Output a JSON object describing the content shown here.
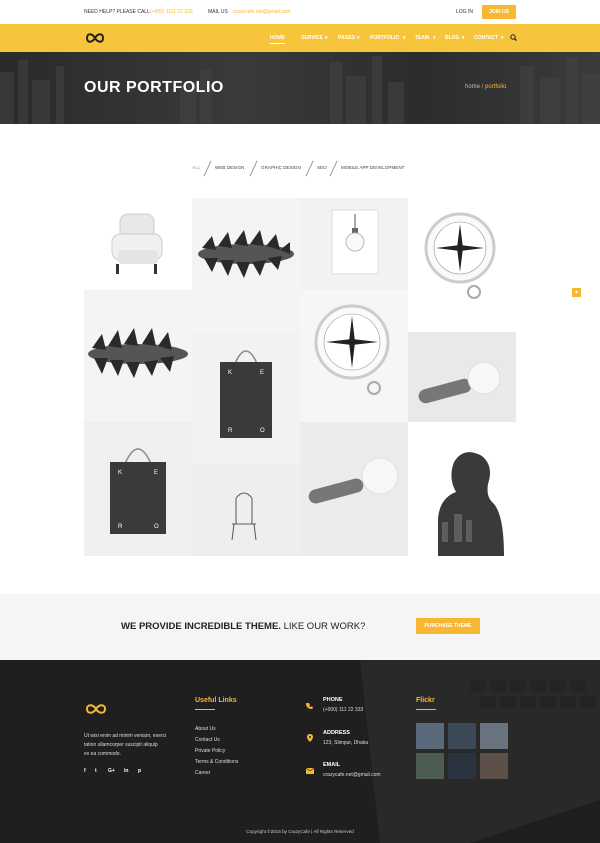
{
  "topbar": {
    "help_label": "NEED HELP? PLEASE CALL",
    "phone": "(+000) 1111 22 333",
    "mail_label": "MAIL US",
    "email": "crazycafe.net@gmail.com",
    "login": "LOG IN",
    "join": "JOIN US"
  },
  "nav": {
    "items": [
      "HOME",
      "SERVICE",
      "PAGES",
      "PORTFOLIO",
      "TEAM",
      "BLOG",
      "CONTACT"
    ]
  },
  "hero": {
    "title": "OUR PORTFOLIO",
    "breadcrumb_home": "home",
    "breadcrumb_sep": " / ",
    "breadcrumb_current": "portfolio"
  },
  "filters": [
    "ALL",
    "WEB DESIGN",
    "GRAPHIC DESIGN",
    "SEO",
    "MOBILE APP DEVELOPMENT"
  ],
  "portfolio": {
    "tiles": [
      "armchair",
      "pine cone",
      "light bulb",
      "compass",
      "pine cone",
      "compass",
      "tote bag",
      "lamp",
      "tote bag",
      "chair",
      "lamp",
      "portrait"
    ]
  },
  "cta": {
    "text_bold": "WE PROVIDE INCREDIBLE THEME.",
    "text_rest": " LIKE OUR WORK?",
    "button": "PURCHASE THEME"
  },
  "footer": {
    "about": [
      "Ut wisi enim ad minim veniam, exerci",
      "tation ullamcorper suscipit aliquip",
      "ex ea commodo."
    ],
    "social": [
      "f",
      "t",
      "G+",
      "in",
      "p"
    ],
    "links_title": "Useful Links",
    "links": [
      "About Us",
      "Contact Us",
      "Private Policy",
      "Terms & Conditions",
      "Career"
    ],
    "phone_head": "PHONE",
    "phone": "(+000) 111 22 333",
    "address_head": "ADDRESS",
    "address": "123, Slimpur, Dhaka",
    "email_head": "EMAIL",
    "email": "crazycafe.net@gmail.com",
    "flickr_title": "Flickr",
    "copyright": "Copyright ©2016 by CrazyCafe   |   All Rights Reserved"
  },
  "colors": {
    "accent": "#f7b733",
    "nav_bg": "#f7c53c",
    "footer_bg": "#1f1f1f",
    "hero_bg": "#333333"
  }
}
